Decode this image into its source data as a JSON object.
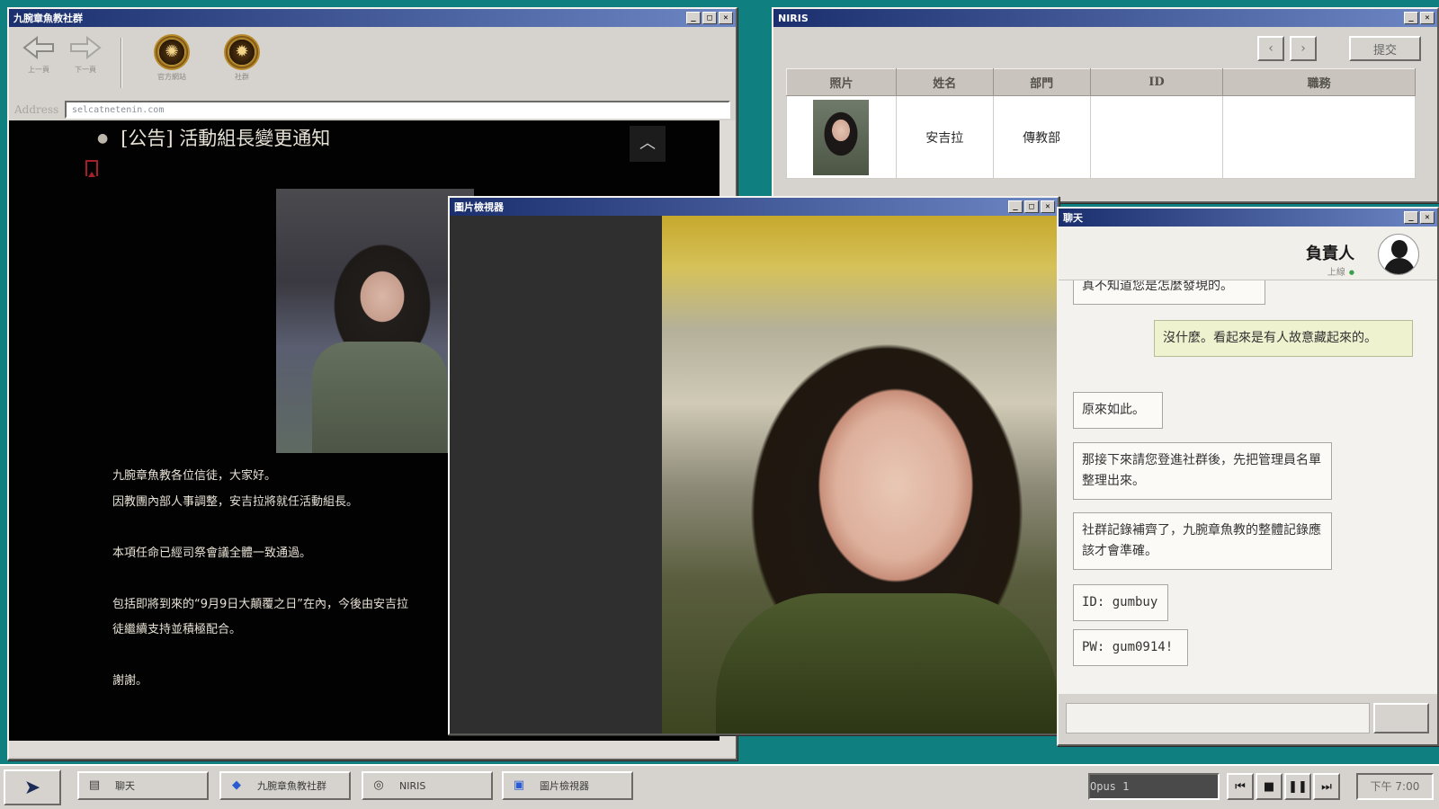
{
  "browser": {
    "title": "九腕章魚教社群",
    "nav": {
      "back_label": "上一頁",
      "forward_label": "下一頁"
    },
    "links": [
      {
        "label": "官方網站"
      },
      {
        "label": "社群"
      }
    ],
    "address_label": "Address",
    "address_value": "selcatnetenin.com",
    "post": {
      "title": "[公告] 活動組長變更通知",
      "lines": [
        "九腕章魚教各位信徒，大家好。",
        "因教團內部人事調整，安吉拉將就任活動組長。",
        "本項任命已經司祭會議全體一致通過。",
        "包括即將到來的“9月9日大顛覆之日”在內，今後由安吉拉",
        "徒繼續支持並積極配合。",
        "謝謝。"
      ]
    }
  },
  "niris": {
    "title": "NIRIS",
    "submit_label": "提交",
    "columns": [
      "照片",
      "姓名",
      "部門",
      "ID",
      "職務"
    ],
    "rows": [
      {
        "name": "安吉拉",
        "department": "傳教部",
        "id": "",
        "role": ""
      }
    ]
  },
  "viewer": {
    "title": "圖片檢視器"
  },
  "chat": {
    "title": "聊天",
    "contact_name": "負責人",
    "contact_status": "上線",
    "messages": [
      {
        "from": "them",
        "text": "真不知道您是怎麼發現的。"
      },
      {
        "from": "me",
        "text": "沒什麼。看起來是有人故意藏起來的。"
      },
      {
        "from": "them",
        "text": "原來如此。"
      },
      {
        "from": "them",
        "text": "那接下來請您登進社群後，先把管理員名單整理出來。"
      },
      {
        "from": "them",
        "text": "社群記錄補齊了，九腕章魚教的整體記錄應該才會準確。"
      },
      {
        "from": "them",
        "text": "ID: gumbuy"
      },
      {
        "from": "them",
        "text": "PW: gum0914!"
      }
    ]
  },
  "taskbar": {
    "tasks": [
      {
        "label": "聊天",
        "icon": "chat-icon"
      },
      {
        "label": "九腕章魚教社群",
        "icon": "globe-icon"
      },
      {
        "label": "NIRIS",
        "icon": "badge-icon"
      },
      {
        "label": "圖片檢視器",
        "icon": "image-icon"
      }
    ],
    "media_readout": "Opus 1",
    "clock": "下午 7:00"
  }
}
